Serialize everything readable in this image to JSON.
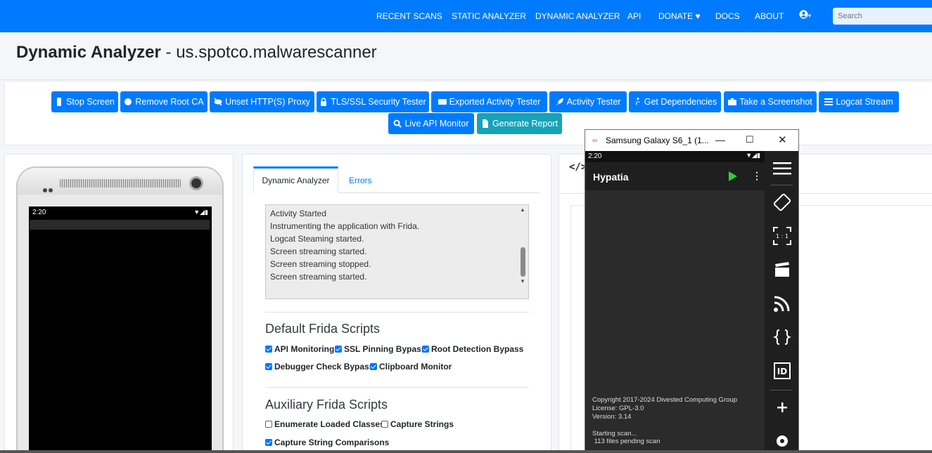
{
  "nav": {
    "items": [
      "RECENT SCANS",
      "STATIC ANALYZER",
      "DYNAMIC ANALYZER",
      "API",
      "DONATE ♥",
      "DOCS",
      "ABOUT"
    ],
    "search_placeholder": "Search"
  },
  "page": {
    "title_bold": "Dynamic Analyzer",
    "title_rest": " - us.spotco.malwarescanner"
  },
  "toolbar": {
    "buttons": [
      "Stop Screen",
      "Remove Root CA",
      "Unset HTTP(S) Proxy",
      "TLS/SSL Security Tester",
      "Exported Activity Tester",
      "Activity Tester",
      "Get Dependencies",
      "Take a Screenshot",
      "Logcat Stream",
      "Live API Monitor",
      "Generate Report"
    ]
  },
  "phone": {
    "time": "2:20"
  },
  "tabs": {
    "active": "Dynamic Analyzer",
    "errors": "Errors"
  },
  "log": {
    "lines": [
      "Activity Started",
      "Instrumenting the application with Frida.",
      "Logcat Steaming started.",
      "Screen streaming started.",
      "Screen streaming stopped.",
      "Screen streaming started."
    ]
  },
  "frida": {
    "default_title": "Default Frida Scripts",
    "default": [
      {
        "label": "API Monitoring",
        "checked": true
      },
      {
        "label": "SSL Pinning Bypass",
        "checked": true
      },
      {
        "label": "Root Detection Bypass",
        "checked": true
      },
      {
        "label": "Debugger Check Bypass",
        "checked": true
      },
      {
        "label": "Clipboard Monitor",
        "checked": true
      }
    ],
    "aux_title": "Auxiliary Frida Scripts",
    "aux": [
      {
        "label": "Enumerate Loaded Classes",
        "checked": false
      },
      {
        "label": "Capture Strings",
        "checked": false
      },
      {
        "label": "Capture String Comparisons",
        "checked": true
      }
    ]
  },
  "right_card": {
    "header_icon": "</>"
  },
  "mirror": {
    "window_title": "Samsung Galaxy S6_1 (1...",
    "time": "2:20",
    "app_title": "Hypatia",
    "info": [
      "Copyright 2017-2024 Divested Computing Group",
      "License: GPL-3.0",
      "Version: 3.14",
      "Starting scan...",
      " 113 files pending scan"
    ],
    "side_label_ratio": "1 : 1",
    "side_label_id": "ID"
  }
}
